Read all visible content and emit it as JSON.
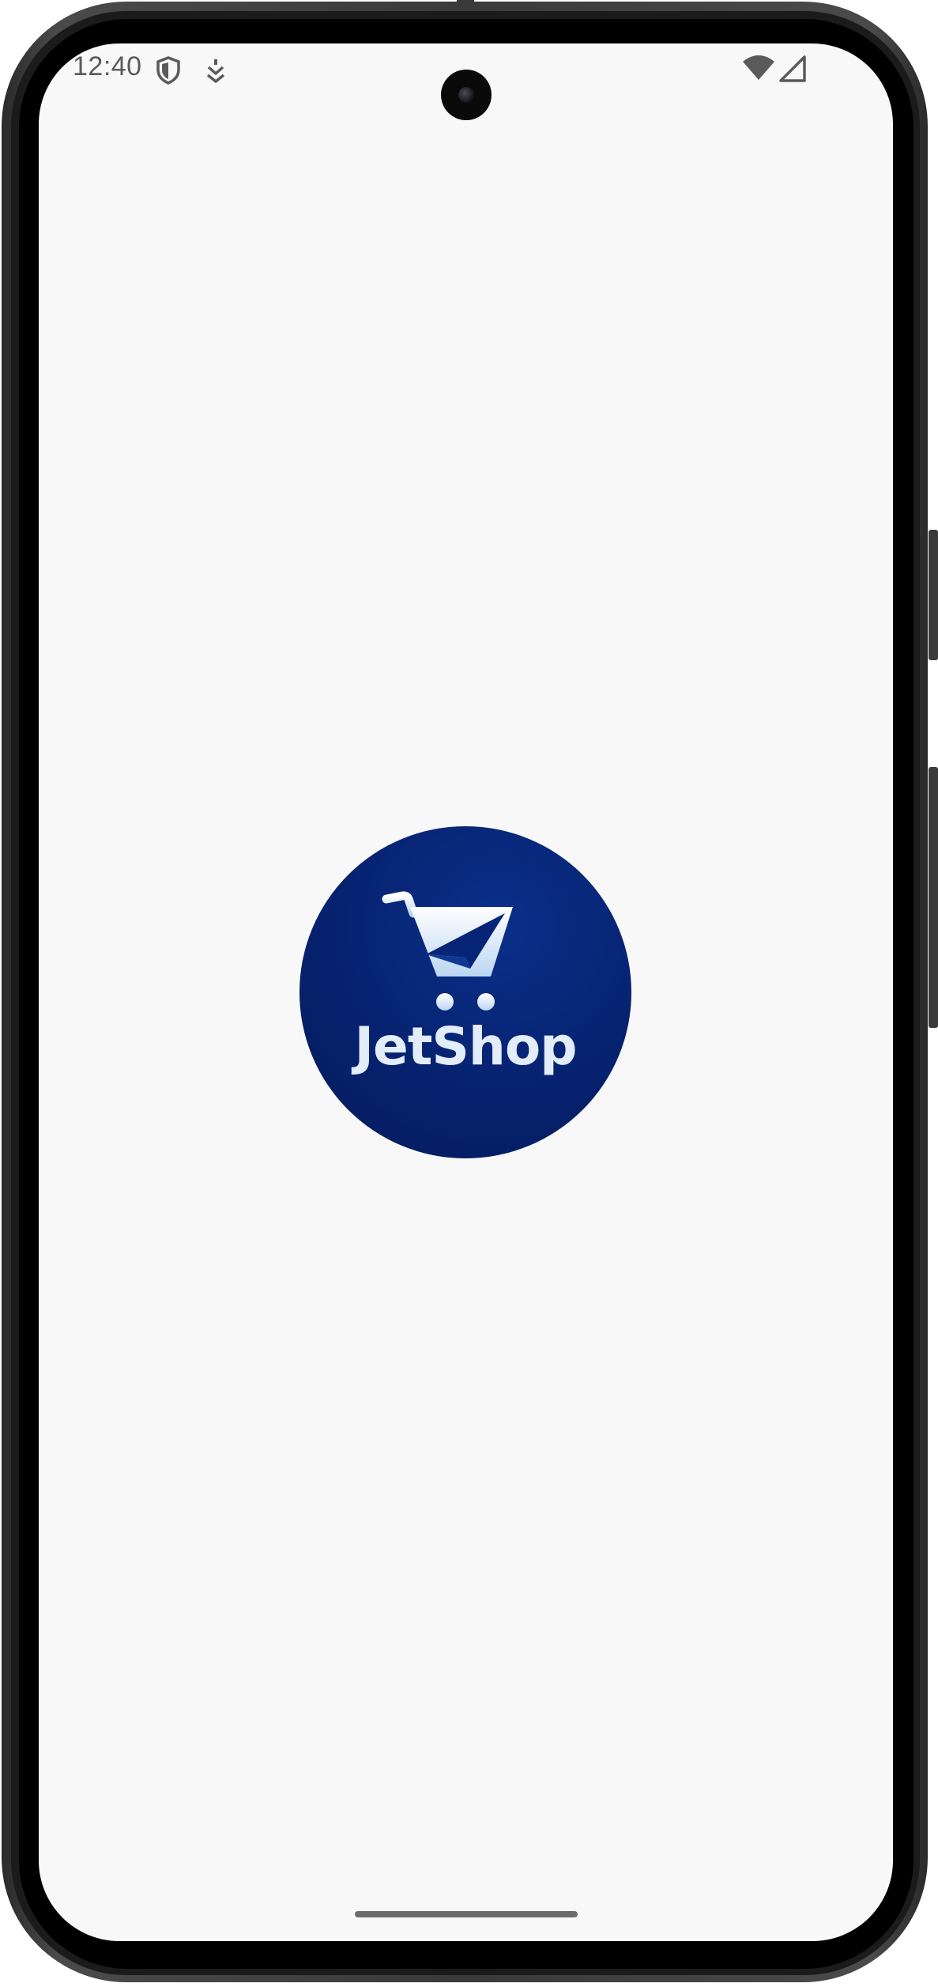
{
  "status_bar": {
    "time": "12:40",
    "left_icons": [
      "shield-icon",
      "download-notification-icon"
    ],
    "right_icons": [
      "wifi-icon",
      "cellular-signal-icon"
    ]
  },
  "app": {
    "logo_text": "JetShop",
    "logo_icon": "shopping-cart-icon"
  },
  "colors": {
    "background": "#f8f8f9",
    "logo_circle": "#06226f",
    "logo_foreground": "#e2edf9"
  }
}
